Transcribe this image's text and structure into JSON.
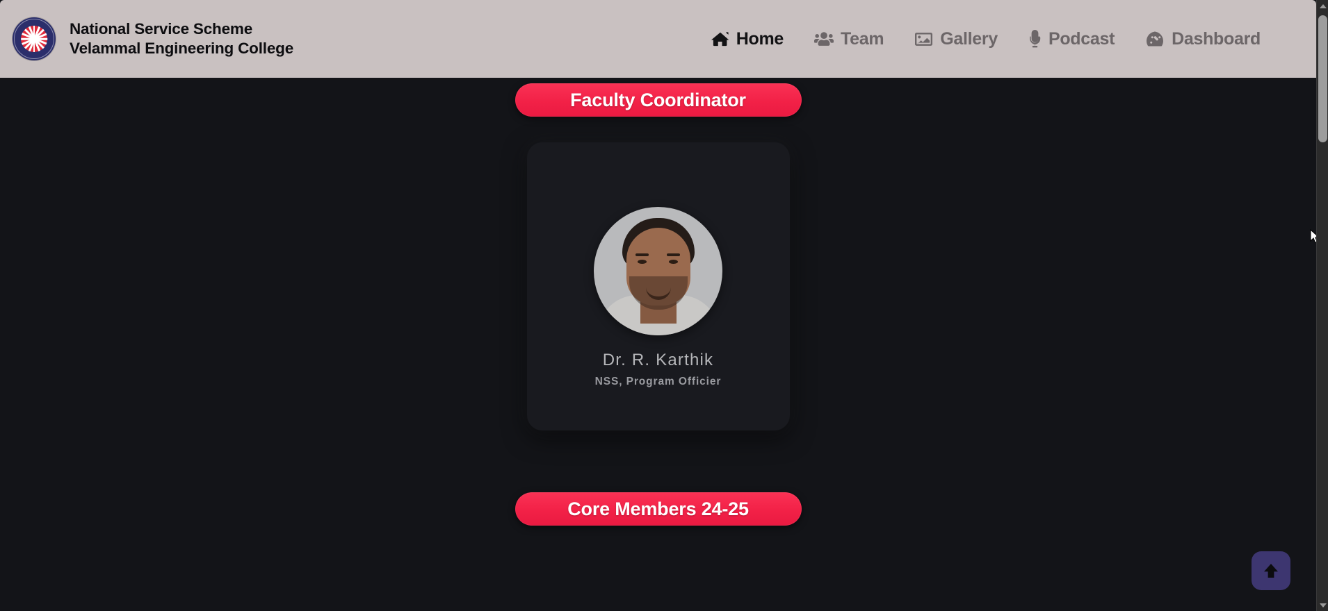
{
  "header": {
    "logo_name": "nss-logo",
    "title_line1": "National Service Scheme",
    "title_line2": "Velammal Engineering College",
    "background_color": "#c9c1c1",
    "nav": [
      {
        "label": "Home",
        "icon": "home-icon",
        "active": true
      },
      {
        "label": "Team",
        "icon": "users-icon",
        "active": false
      },
      {
        "label": "Gallery",
        "icon": "image-icon",
        "active": false
      },
      {
        "label": "Podcast",
        "icon": "microphone-icon",
        "active": false
      },
      {
        "label": "Dashboard",
        "icon": "gauge-icon",
        "active": false
      }
    ]
  },
  "main": {
    "background_color": "#131418",
    "banner_color": "#f22147",
    "faculty_banner": "Faculty Coordinator",
    "core_banner": "Core Members 24-25",
    "faculty_card": {
      "name": "Dr. R. Karthik",
      "role": "NSS, Program Officier",
      "photo_alt": "faculty-portrait",
      "card_color": "#191a1f"
    }
  },
  "controls": {
    "scroll_top_label": "scroll-to-top",
    "scroll_top_color": "#3d3670"
  }
}
